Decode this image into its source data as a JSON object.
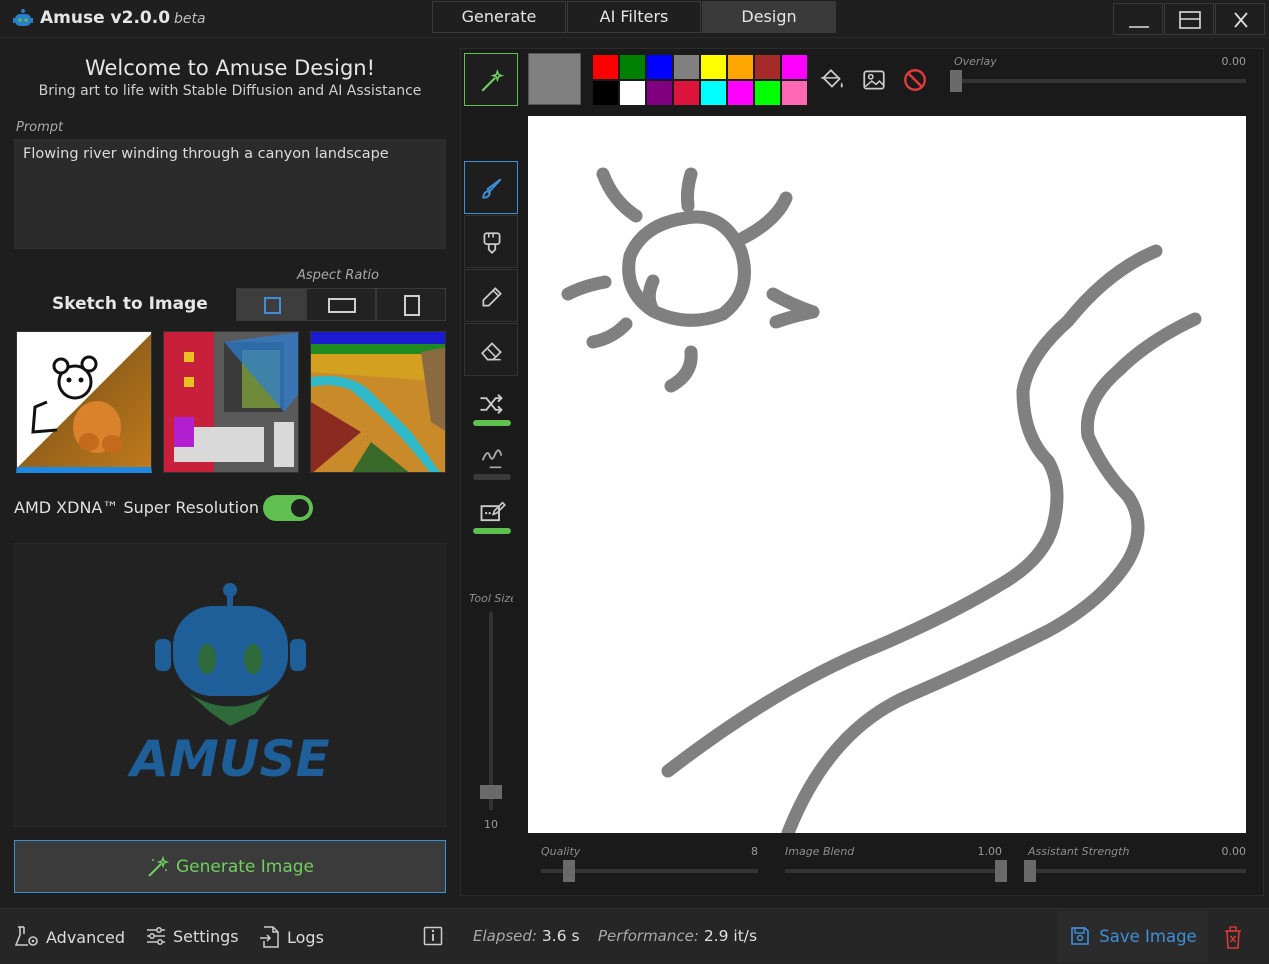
{
  "app": {
    "title": "Amuse v2.0.0",
    "beta": "beta",
    "tabs": [
      {
        "label": "Generate",
        "active": false
      },
      {
        "label": "AI Filters",
        "active": false
      },
      {
        "label": "Design",
        "active": true
      }
    ]
  },
  "left": {
    "welcome": "Welcome to Amuse Design!",
    "subtitle": "Bring art to life with Stable Diffusion and AI Assistance",
    "prompt_label": "Prompt",
    "prompt_value": "Flowing river winding through a canyon landscape",
    "aspect_ratio_label": "Aspect Ratio",
    "aspect_options": [
      "square",
      "landscape",
      "portrait"
    ],
    "aspect_selected": "square",
    "mode_title": "Sketch to Image",
    "super_resolution_label": "AMD XDNA™ Super Resolution",
    "super_resolution_on": true,
    "preview_logo_text": "AMUSE",
    "generate_label": "Generate Image"
  },
  "bottom": {
    "advanced": "Advanced",
    "settings": "Settings",
    "logs": "Logs",
    "elapsed_label": "Elapsed:",
    "elapsed_value": "3.6 s",
    "performance_label": "Performance:",
    "performance_value": "2.9 it/s",
    "save_label": "Save Image"
  },
  "design": {
    "current_color": "#808080",
    "palette": [
      "#ff0000",
      "#008000",
      "#0000ff",
      "#808080",
      "#ffff00",
      "#ffa500",
      "#a52a2a",
      "#ff00ff",
      "#000000",
      "#ffffff",
      "#800080",
      "#dc143c",
      "#00ffff",
      "#ff00ff",
      "#00ff00",
      "#ff69b4"
    ],
    "overlay_label": "Overlay",
    "overlay_value": "0.00",
    "tool_size_label": "Tool Size",
    "tool_size_value": "10",
    "quality_label": "Quality",
    "quality_value": "8",
    "image_blend_label": "Image Blend",
    "image_blend_value": "1.00",
    "assistant_strength_label": "Assistant Strength",
    "assistant_strength_value": "0.00",
    "stroke_color": "#808080"
  },
  "colors": {
    "accent_blue": "#3d8fd8",
    "accent_green": "#5fbf4f"
  }
}
